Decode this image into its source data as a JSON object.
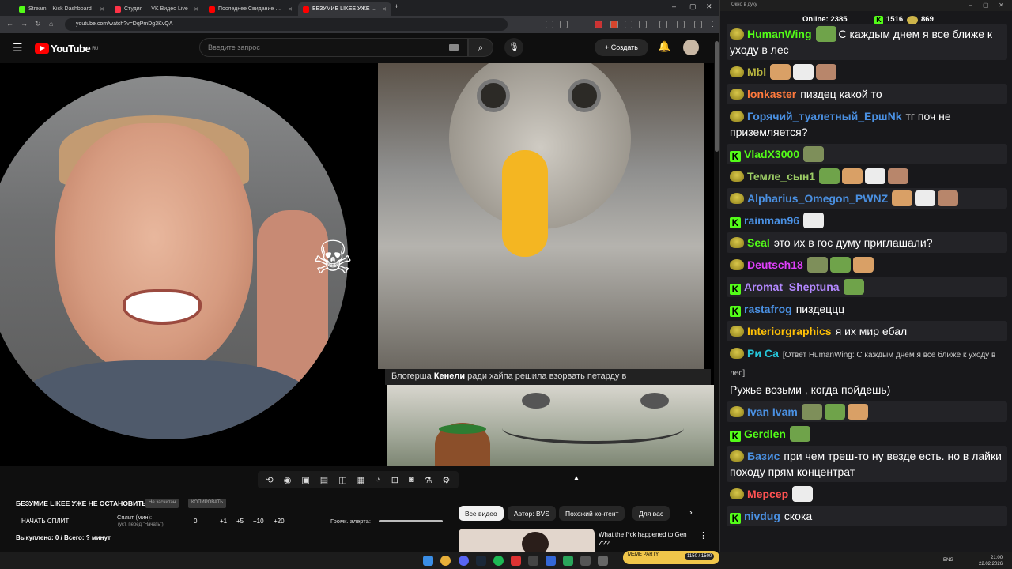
{
  "browser": {
    "tabs": [
      {
        "label": "Stream – Kick Dashboard",
        "color": "#53fc18"
      },
      {
        "label": "Студия — VK Видео Live",
        "color": "#ff3347"
      },
      {
        "label": "Последнее Свидание Яйцеса...",
        "color": "#ff0000"
      },
      {
        "label": "БЕЗУМИЕ LIKEE УЖЕ НЕ ОСТ...",
        "color": "#ff0000"
      }
    ],
    "url": "youtube.com/watch?v=DqPmDg3KvQA"
  },
  "youtube": {
    "logo": "YouTube",
    "region": "RU",
    "search_placeholder": "Введите запрос",
    "create_label": "Создать"
  },
  "video": {
    "caption_prefix": "Блогерша ",
    "caption_name": "Кенели",
    "caption_rest": " ради хайпа решила взорвать петарду в"
  },
  "below": {
    "title": "БЕЗУМИЕ LIKEE УЖЕ НЕ ОСТАНОВИТЬ",
    "pill1": "Не засчитан",
    "pill2": "КОПИРОВАТЬ",
    "start_split": "НАЧАТЬ СПЛИТ",
    "split_label": "Сплит (мин):",
    "split_sub": "(уст. перед \"Начать\")",
    "split_value": "0",
    "inc": [
      "+1",
      "+5",
      "+10",
      "+20"
    ],
    "volume_label": "Громк. алерта:",
    "bought": "Выкуплено: 0 / Всего: ? минут"
  },
  "chips": [
    "Все видео",
    "Автор: BVS",
    "Похожий контент",
    "Для вас"
  ],
  "related": {
    "title": "What the f*ck happened to Gen Z??"
  },
  "chat": {
    "window_title": "Окно в дуку",
    "online_label": "Online:",
    "online": "2385",
    "kick_count": "1516",
    "pepe_count": "869",
    "messages": [
      {
        "user": "HumanWing",
        "color": "#53fc18",
        "badge": "pepe",
        "text": "С каждым днем я все ближе к уходу в лес",
        "emotes": 1
      },
      {
        "user": "Mbl",
        "color": "#b9b53f",
        "badge": "pepe",
        "text": "",
        "emotes": 3
      },
      {
        "user": "lonkaster",
        "color": "#ff7a3d",
        "badge": "pepe",
        "text": "пиздец какой то",
        "emotes": 0
      },
      {
        "user": "Горячий_туалетный_ЕршNk",
        "color": "#4a90e2",
        "badge": "pepe",
        "text": "тг поч не приземляется?",
        "emotes": 0
      },
      {
        "user": "VladX3000",
        "color": "#53fc18",
        "badge": "kick",
        "text": "",
        "emotes": 1
      },
      {
        "user": "Темле_сын1",
        "color": "#9ccc65",
        "badge": "pepe",
        "text": "",
        "emotes": 4
      },
      {
        "user": "Alpharius_Omegon_PWNZ",
        "color": "#4a90e2",
        "badge": "pepe",
        "text": "",
        "emotes": 3
      },
      {
        "user": "rainman96",
        "color": "#4a90e2",
        "badge": "kick",
        "text": "",
        "emotes": 1
      },
      {
        "user": "Seal",
        "color": "#53fc18",
        "badge": "pepe",
        "text": "это их в гос думу приглашали?",
        "emotes": 0
      },
      {
        "user": "Deutsch18",
        "color": "#e040fb",
        "badge": "pepe",
        "text": "",
        "emotes": 3
      },
      {
        "user": "Aromat_Sheptuna",
        "color": "#b388ff",
        "badge": "kick",
        "text": "",
        "emotes": 1
      },
      {
        "user": "rastafrog",
        "color": "#4a90e2",
        "badge": "kick",
        "text": "пиздеццц",
        "emotes": 0
      },
      {
        "user": "Interiorgraphics",
        "color": "#ffc107",
        "badge": "pepe",
        "text": "я их мир ебал",
        "emotes": 0
      },
      {
        "user": "Ри Са",
        "color": "#26c6da",
        "badge": "pepe",
        "text": "Ружье возьми , когда пойдешь)",
        "reply": "[Ответ HumanWing: С каждым днем я всё ближе к уходу в лес]",
        "emotes": 0
      },
      {
        "user": "Ivan Ivam",
        "color": "#4a90e2",
        "badge": "pepe",
        "text": "",
        "emotes": 3
      },
      {
        "user": "Gerdlen",
        "color": "#53fc18",
        "badge": "kick",
        "text": "",
        "emotes": 1
      },
      {
        "user": "Базис",
        "color": "#4a90e2",
        "badge": "pepe",
        "text": "при чем треш-то ну везде есть. но в лайки походу прям концентрат",
        "emotes": 0
      },
      {
        "user": "Мерсер",
        "color": "#ff5252",
        "badge": "pepe",
        "text": "",
        "emotes": 1
      },
      {
        "user": "nivdug",
        "color": "#4a90e2",
        "badge": "kick",
        "text": "скока",
        "emotes": 0
      }
    ]
  },
  "taskbar": {
    "lang": "ENG",
    "time": "21:00",
    "date": "22.02.2026",
    "meme_widget": "MEME PARTY",
    "meme_progress": "1150 / 1500"
  }
}
